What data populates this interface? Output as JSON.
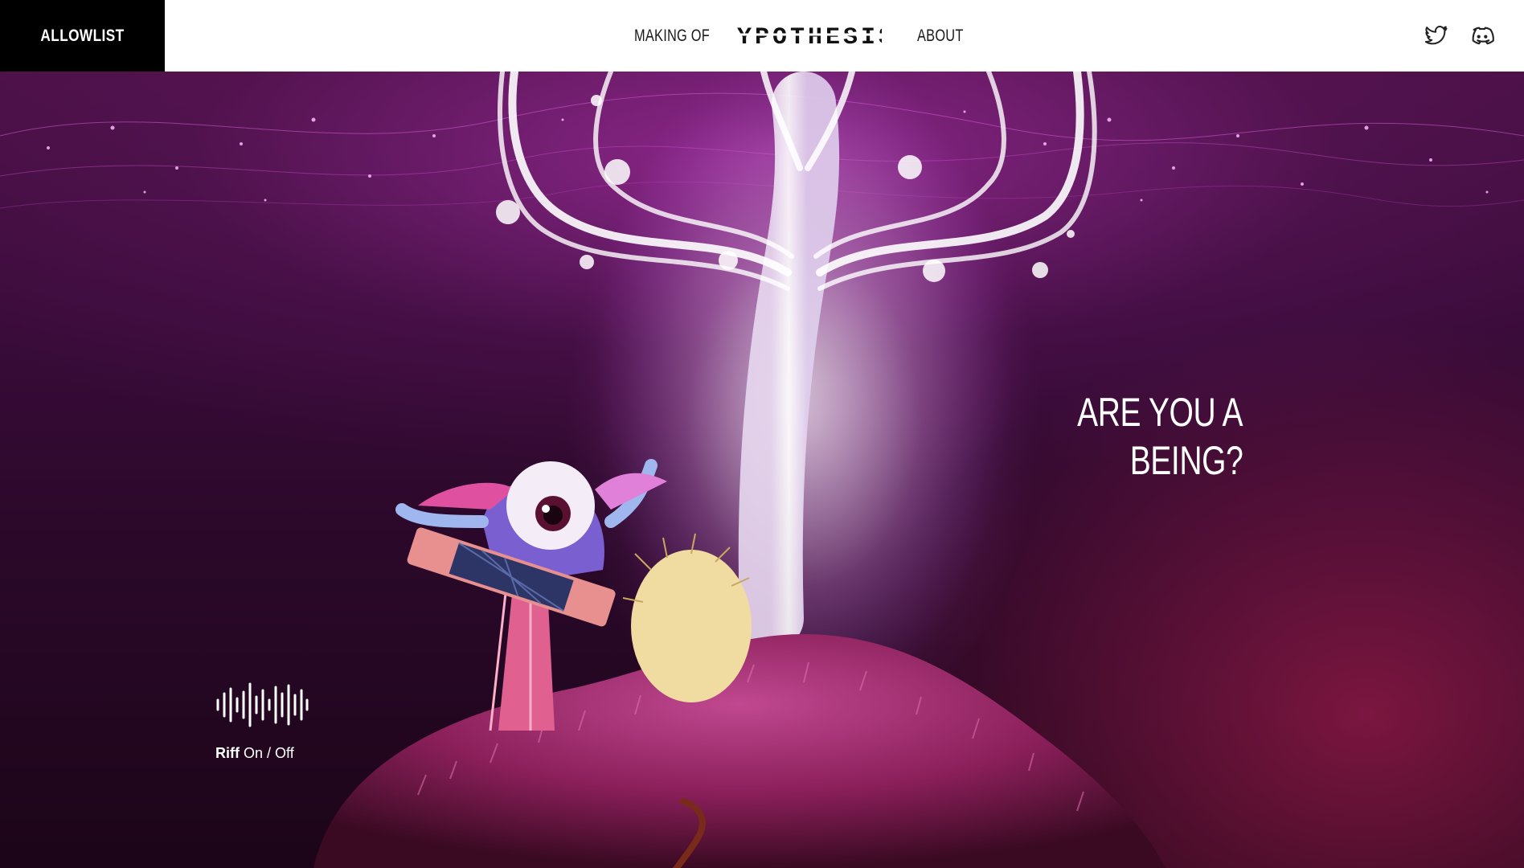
{
  "header": {
    "allowlist_label": "ALLOWLIST",
    "nav": {
      "making_of": "MAKING OF",
      "logo_text": "HYPOTHESIS",
      "about": "ABOUT"
    },
    "social": {
      "twitter_icon": "twitter-icon",
      "discord_icon": "discord-icon"
    }
  },
  "hero": {
    "headline_line1": "ARE YOU A",
    "headline_line2": "BEING?",
    "riff": {
      "label": "Riff",
      "toggle": "On / Off",
      "icon": "soundwave-icon"
    }
  },
  "colors": {
    "topbar_bg": "#ffffff",
    "allowlist_bg": "#000000",
    "text_light": "#ffffff",
    "accent_purple": "#c040c0"
  }
}
